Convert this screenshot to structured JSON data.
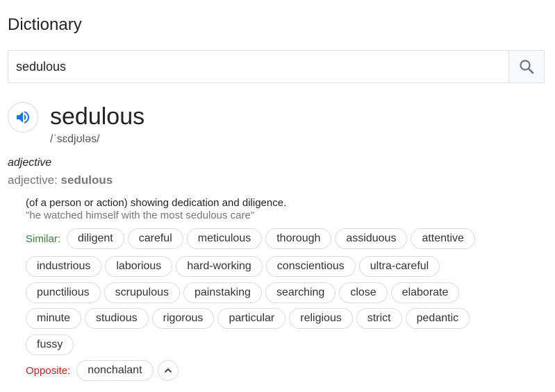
{
  "page_title": "Dictionary",
  "search": {
    "value": "sedulous",
    "icon": "search-icon"
  },
  "entry": {
    "word": "sedulous",
    "phonetic": "/ˈsɛdjʊləs/",
    "part_of_speech": "adjective",
    "pos_prefix": "adjective: ",
    "pos_word": "sedulous",
    "definition": "(of a person or action) showing dedication and diligence.",
    "example": "\"he watched himself with the most sedulous care\"",
    "similar_label": "Similar:",
    "similar_rows": [
      [
        "diligent",
        "careful",
        "meticulous",
        "thorough",
        "assiduous",
        "attentive"
      ],
      [
        "industrious",
        "laborious",
        "hard-working",
        "conscientious",
        "ultra-careful"
      ],
      [
        "punctilious",
        "scrupulous",
        "painstaking",
        "searching",
        "close",
        "elaborate"
      ],
      [
        "minute",
        "studious",
        "rigorous",
        "particular",
        "religious",
        "strict",
        "pedantic"
      ],
      [
        "fussy"
      ]
    ],
    "opposite_label": "Opposite:",
    "opposites": [
      "nonchalant"
    ]
  },
  "colors": {
    "similar_label": "#3c7a3e",
    "opposite_label": "#c5221f",
    "speaker_icon": "#1a73e8"
  }
}
